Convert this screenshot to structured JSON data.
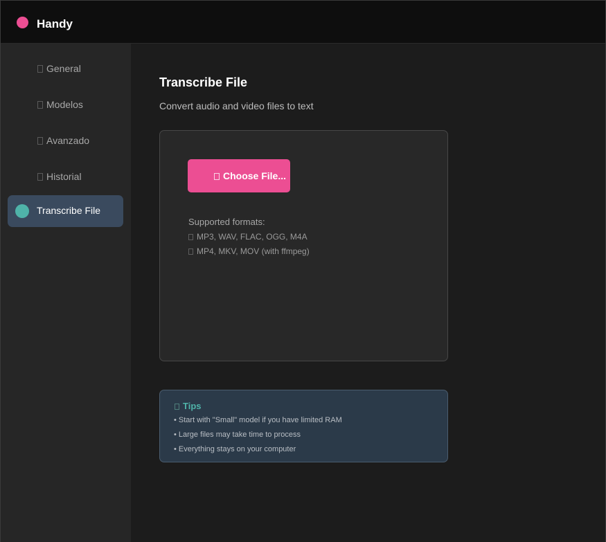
{
  "app": {
    "name": "Handy",
    "brand_color": "#ec4e93"
  },
  "sidebar": {
    "items": [
      {
        "label": "General",
        "icon": "settings-icon"
      },
      {
        "label": "Modelos",
        "icon": "model-icon"
      },
      {
        "label": "Avanzado",
        "icon": "advanced-icon"
      },
      {
        "label": "Historial",
        "icon": "history-icon"
      },
      {
        "label": "Transcribe File",
        "icon": "active-indicator",
        "active": true
      }
    ],
    "active_color": "#3a4a5e",
    "indicator_color": "#4fb3a9"
  },
  "main": {
    "title": "Transcribe File",
    "subtitle": "Convert audio and video files to text",
    "choose_button": {
      "label": "Choose File...",
      "icon": "file-icon",
      "color": "#ec4e93"
    },
    "formats": {
      "title": "Supported formats:",
      "lines": [
        {
          "text": "MP3, WAV, FLAC, OGG, M4A",
          "icon": "audio-icon"
        },
        {
          "text": "MP4, MKV, MOV (with ffmpeg)",
          "icon": "video-icon"
        }
      ]
    },
    "tips": {
      "title": "Tips",
      "icon": "lightbulb-icon",
      "accent_color": "#4fb3a9",
      "items": [
        "• Start with \"Small\" model if you have limited RAM",
        "• Large files may take time to process",
        "• Everything stays on your computer"
      ]
    }
  }
}
